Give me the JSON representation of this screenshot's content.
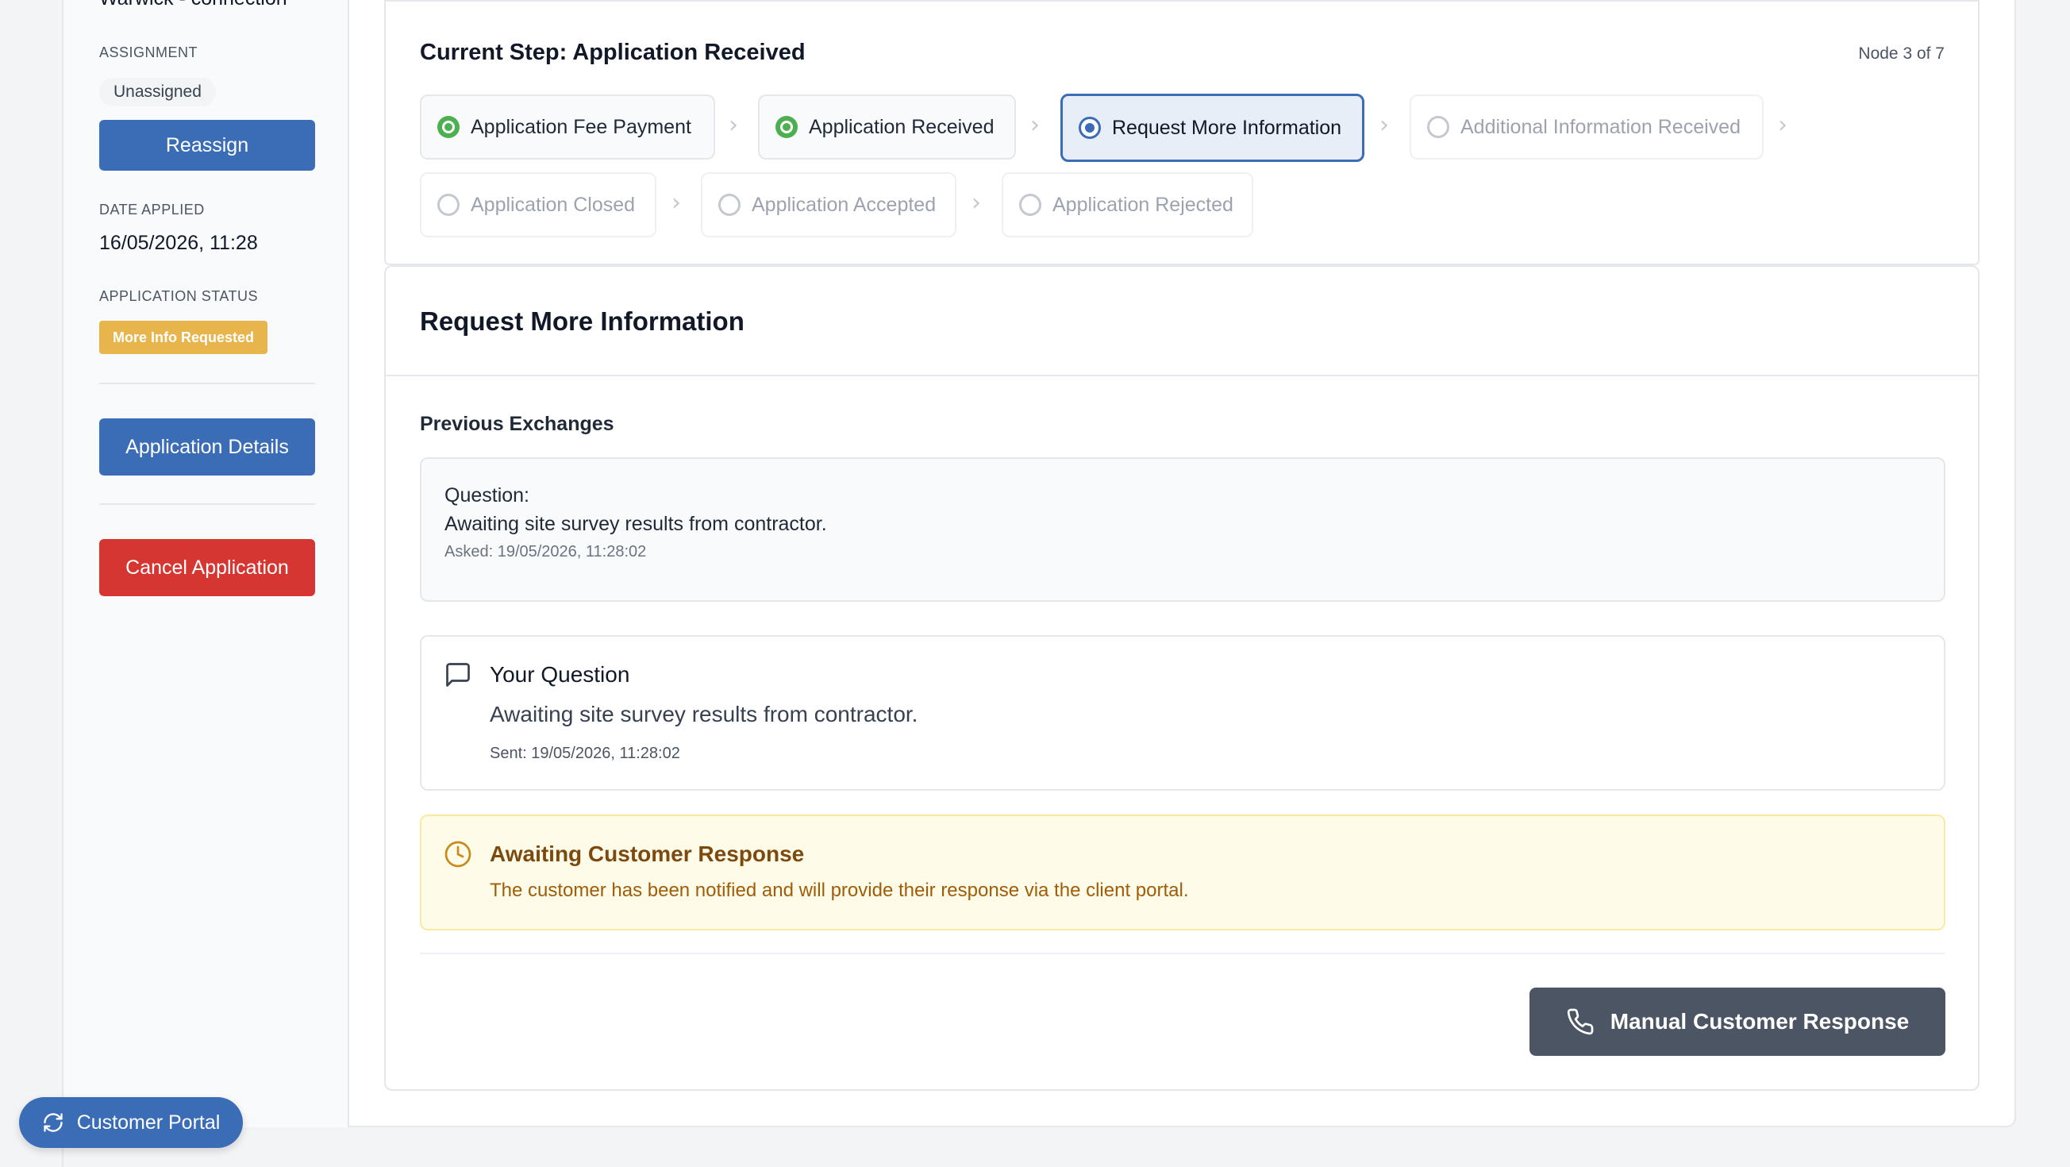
{
  "sidebar": {
    "cut_text": "Warwick - connection",
    "assignment_label": "ASSIGNMENT",
    "assignee": "Unassigned",
    "reassign_label": "Reassign",
    "date_applied_label": "DATE APPLIED",
    "date_applied": "16/05/2026, 11:28",
    "status_label": "APPLICATION STATUS",
    "status_badge": "More Info Requested",
    "details_button": "Application Details",
    "cancel_button": "Cancel Application"
  },
  "stepper": {
    "title": "Current Step: Application Received",
    "node_count": "Node 3 of 7",
    "steps": [
      {
        "label": "Application Fee Payment",
        "state": "done"
      },
      {
        "label": "Application Received",
        "state": "done"
      },
      {
        "label": "Request More Information",
        "state": "current"
      },
      {
        "label": "Additional Information Received",
        "state": "pending"
      },
      {
        "label": "Application Closed",
        "state": "pending"
      },
      {
        "label": "Application Accepted",
        "state": "pending"
      },
      {
        "label": "Application Rejected",
        "state": "pending"
      }
    ]
  },
  "detail": {
    "title": "Request More Information",
    "previous_heading": "Previous Exchanges",
    "exchange": {
      "question_label": "Question:",
      "question_text": "Awaiting site survey results from contractor.",
      "asked": "Asked: 19/05/2026, 11:28:02"
    },
    "your_question": {
      "title": "Your Question",
      "text": "Awaiting site survey results from contractor.",
      "sent": "Sent: 19/05/2026, 11:28:02"
    },
    "awaiting": {
      "title": "Awaiting Customer Response",
      "text": "The customer has been notified and will provide their response via the client portal."
    },
    "manual_button": "Manual Customer Response"
  },
  "portal_button": "Customer Portal",
  "colors": {
    "primary": "#3b6db7",
    "danger": "#d63631",
    "warning": "#e8b44c",
    "success": "#4caf50",
    "neutral_button": "#4b5563"
  }
}
